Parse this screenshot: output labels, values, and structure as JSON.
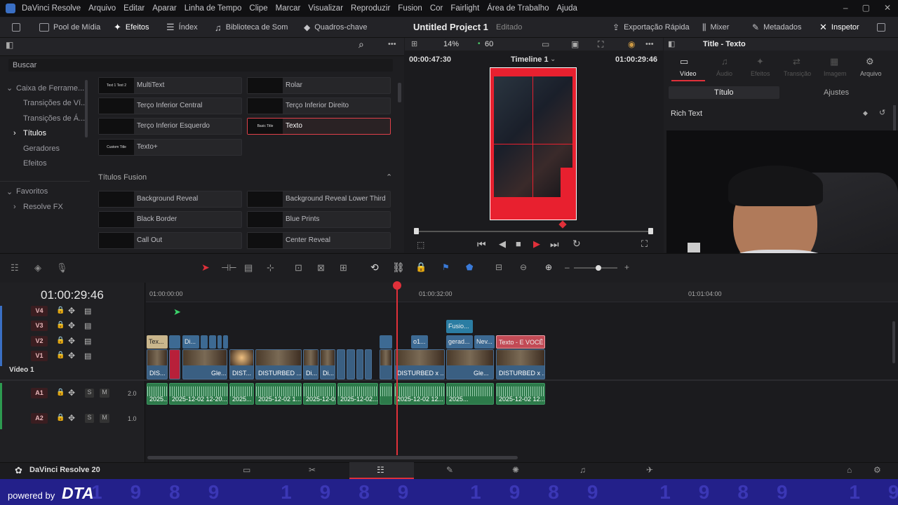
{
  "menu": {
    "app": "DaVinci Resolve",
    "items": [
      "Arquivo",
      "Editar",
      "Aparar",
      "Linha de Tempo",
      "Clipe",
      "Marcar",
      "Visualizar",
      "Reproduzir",
      "Fusion",
      "Cor",
      "Fairlight",
      "Área de Trabalho",
      "Ajuda"
    ]
  },
  "toolbar": {
    "media_pool": "Pool de Mídia",
    "effects": "Efeitos",
    "index": "Índex",
    "sound_library": "Biblioteca de Som",
    "keyframes": "Quadros-chave",
    "project_title": "Untitled Project 1",
    "project_status": "Editado",
    "quick_export": "Exportação Rápida",
    "mixer": "Mixer",
    "metadata": "Metadados",
    "inspector": "Inspetor"
  },
  "effects": {
    "search_placeholder": "Buscar",
    "tree": {
      "toolbox": "Caixa de Ferrame...",
      "video_transitions": "Transições de Ví...",
      "audio_transitions": "Transições de Á...",
      "titles": "Títulos",
      "generators": "Geradores",
      "effects": "Efeitos",
      "favorites": "Favoritos",
      "resolve_fx": "Resolve FX"
    },
    "titles": [
      {
        "label": "MultiText",
        "thumb": "Text 1 Text 2"
      },
      {
        "label": "Rolar",
        "thumb": ""
      },
      {
        "label": "Terço Inferior Central",
        "thumb": ""
      },
      {
        "label": "Terço Inferior Direito",
        "thumb": ""
      },
      {
        "label": "Terço Inferior Esquerdo",
        "thumb": ""
      },
      {
        "label": "Texto",
        "thumb": "Basic Title"
      },
      {
        "label": "Texto+",
        "thumb": "Custom Title"
      }
    ],
    "fusion_section": "Títulos Fusion",
    "fusion_titles": [
      {
        "label": "Background Reveal"
      },
      {
        "label": "Background Reveal Lower Third"
      },
      {
        "label": "Black Border"
      },
      {
        "label": "Blue Prints"
      },
      {
        "label": "Call Out"
      },
      {
        "label": "Center Reveal"
      }
    ]
  },
  "viewer": {
    "zoom": "14%",
    "fps": "60",
    "timecode_left": "00:00:47:30",
    "timeline_name": "Timeline 1",
    "timecode_right": "01:00:29:46"
  },
  "inspector": {
    "title": "Title - Texto",
    "tabs": [
      "Vídeo",
      "Áudio",
      "Efeitos",
      "Transição",
      "Imagem",
      "Arquivo"
    ],
    "subtabs": [
      "Título",
      "Ajustes"
    ],
    "section": "Rich Text"
  },
  "timeline": {
    "timecode": "01:00:29:46",
    "ruler": [
      "01:00:00:00",
      "01:00:32:00",
      "01:01:04:00"
    ],
    "tracks": {
      "v4": "V4",
      "v3": "V3",
      "v2": "V2",
      "v1": "V1",
      "video1": "Vídeo 1",
      "a1": "A1",
      "a2": "A2",
      "a1_vol": "2.0",
      "a2_vol": "1.0",
      "s": "S",
      "m": "M"
    },
    "v3_clips": [
      "Fusio..."
    ],
    "v2_clips": [
      "Tex...",
      "Di...",
      "o1...",
      "gerad...",
      "Nev...",
      "Texto - E VOCÊ"
    ],
    "v1_clips": [
      "DIS...",
      "Gle...",
      "DIST...",
      "DISTURBED ...",
      "Di...",
      "Di...",
      "DISTURBED x ...",
      "Gle...",
      "DISTURBED x ..."
    ],
    "a1_clips": [
      "2025...",
      "2025-12-02 12-20...",
      "2025...",
      "2025-12-02 1...",
      "2025-12-02 1...",
      "2025-12-02...",
      "2025-12-02 12...",
      "2025...",
      "2025-12-02 12..."
    ]
  },
  "bottom": {
    "app_version": "DaVinci Resolve 20"
  },
  "brand": {
    "powered_by": "powered by",
    "name": "DTA",
    "watermark": "1989"
  }
}
